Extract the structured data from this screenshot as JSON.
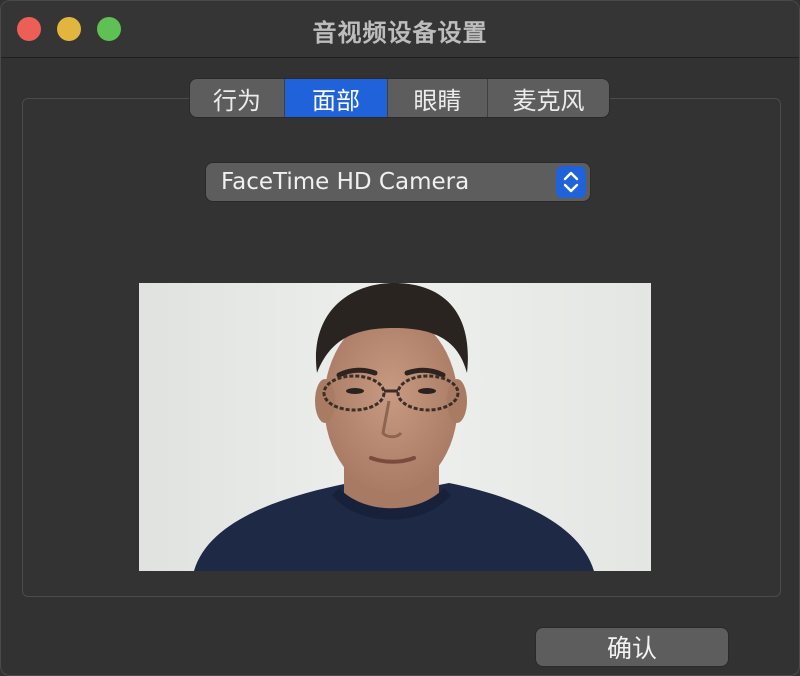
{
  "window": {
    "title": "音视频设备设置"
  },
  "tabs": [
    {
      "label": "行为",
      "selected": false
    },
    {
      "label": "面部",
      "selected": true
    },
    {
      "label": "眼睛",
      "selected": false
    },
    {
      "label": "麦克风",
      "selected": false
    }
  ],
  "camera_select": {
    "value": "FaceTime HD Camera",
    "icon": "chevron-up-down-icon"
  },
  "preview": {
    "content": "camera-preview"
  },
  "footer": {
    "ok_label": "确认"
  },
  "colors": {
    "accent": "#1f62d9",
    "close": "#ec5f57",
    "minimize": "#e2b53f",
    "maximize": "#5fc153"
  }
}
